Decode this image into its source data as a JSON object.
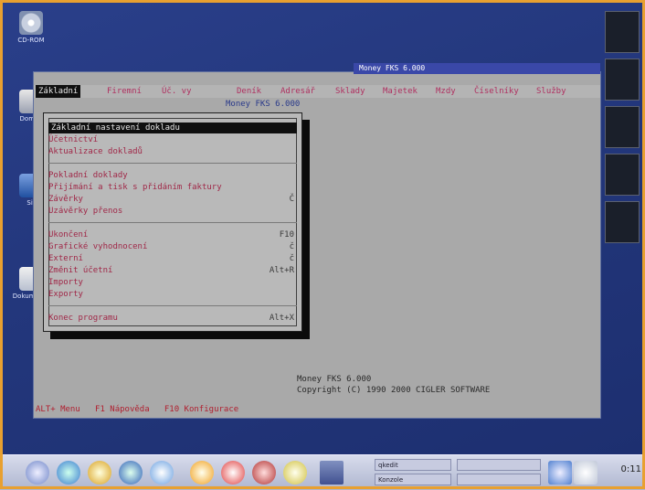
{
  "desktop": {
    "icons": [
      {
        "name": "cd-icon",
        "label": "CD-ROM"
      },
      {
        "name": "home-icon",
        "label": "Domov"
      },
      {
        "name": "network-icon",
        "label": "Sit"
      },
      {
        "name": "document-icon",
        "label": "Dokumenty"
      }
    ]
  },
  "window": {
    "title": "Money FKS 6.000",
    "heading": "Money FKS 6.000"
  },
  "menubar": {
    "items": [
      {
        "label": "Základní",
        "active": true
      },
      {
        "label": "Firemní"
      },
      {
        "label": "Úč. vy"
      },
      {
        "label": "Deník"
      },
      {
        "label": "Adresář"
      },
      {
        "label": "Sklady"
      },
      {
        "label": "Majetek"
      },
      {
        "label": "Mzdy"
      },
      {
        "label": "Číselníky"
      },
      {
        "label": "Služby"
      }
    ]
  },
  "dropdown": {
    "items": [
      {
        "label": "Základní nastavení dokladu",
        "key": "",
        "selected": true
      },
      {
        "label": "Účetnictví",
        "key": ""
      },
      {
        "label": "Aktualizace dokladů",
        "key": ""
      },
      {
        "label": "Pokladní doklady",
        "key": ""
      },
      {
        "label": "Přijímání a tisk s přidáním faktury",
        "key": ""
      },
      {
        "label": "Závěrky",
        "key": "Č"
      },
      {
        "label": "Uzávěrky přenos",
        "key": ""
      },
      {
        "label": "Ukončení",
        "key": "F10"
      },
      {
        "label": "Grafické vyhodnocení",
        "key": "č"
      },
      {
        "label": "Externí",
        "key": "č"
      },
      {
        "label": "Změnit účetní",
        "key": "Alt+R"
      },
      {
        "label": "Importy",
        "key": ""
      },
      {
        "label": "Exporty",
        "key": ""
      },
      {
        "label": "Konec programu",
        "key": "Alt+X"
      }
    ]
  },
  "info": {
    "line1": "Money FKS 6.000",
    "line2": "Copyright (C) 1990 2000 CIGLER SOFTWARE"
  },
  "status": {
    "text": "ALT+ Menu   F1 Nápověda   F10 Konfigurace"
  },
  "taskbar": {
    "tasks": [
      {
        "label": "qkedit"
      },
      {
        "label": "Konzole"
      }
    ],
    "clock": "0:11"
  }
}
